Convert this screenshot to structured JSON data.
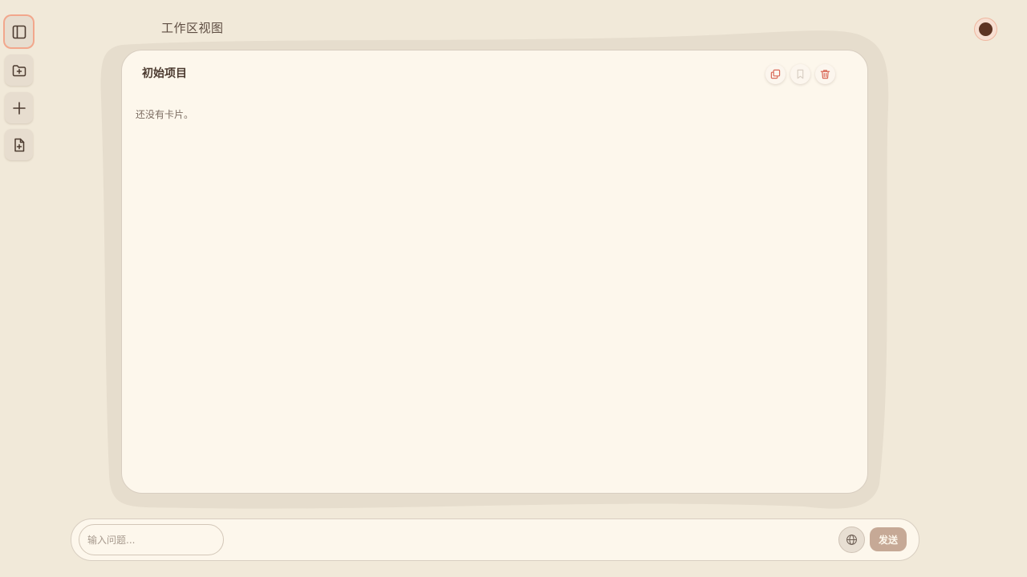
{
  "header": {
    "workspace_title": "工作区视图"
  },
  "sidebar": {
    "buttons": [
      {
        "icon": "sidebar-toggle-icon",
        "active": true
      },
      {
        "icon": "folder-plus-icon",
        "active": false
      },
      {
        "icon": "plus-icon",
        "active": false
      },
      {
        "icon": "file-plus-icon",
        "active": false
      }
    ]
  },
  "project": {
    "title": "初始项目",
    "empty_message": "还没有卡片。",
    "actions": [
      "copy-icon",
      "bookmark-icon",
      "trash-icon"
    ]
  },
  "chat": {
    "input_placeholder": "输入问题...",
    "input_value": "",
    "send_label": "发送",
    "globe_icon": "globe-icon"
  },
  "colors": {
    "background": "#f1e9d9",
    "card": "#fdf7ec",
    "accent": "#f2a78c",
    "danger": "#d96a58",
    "send_button": "#c6a996"
  }
}
